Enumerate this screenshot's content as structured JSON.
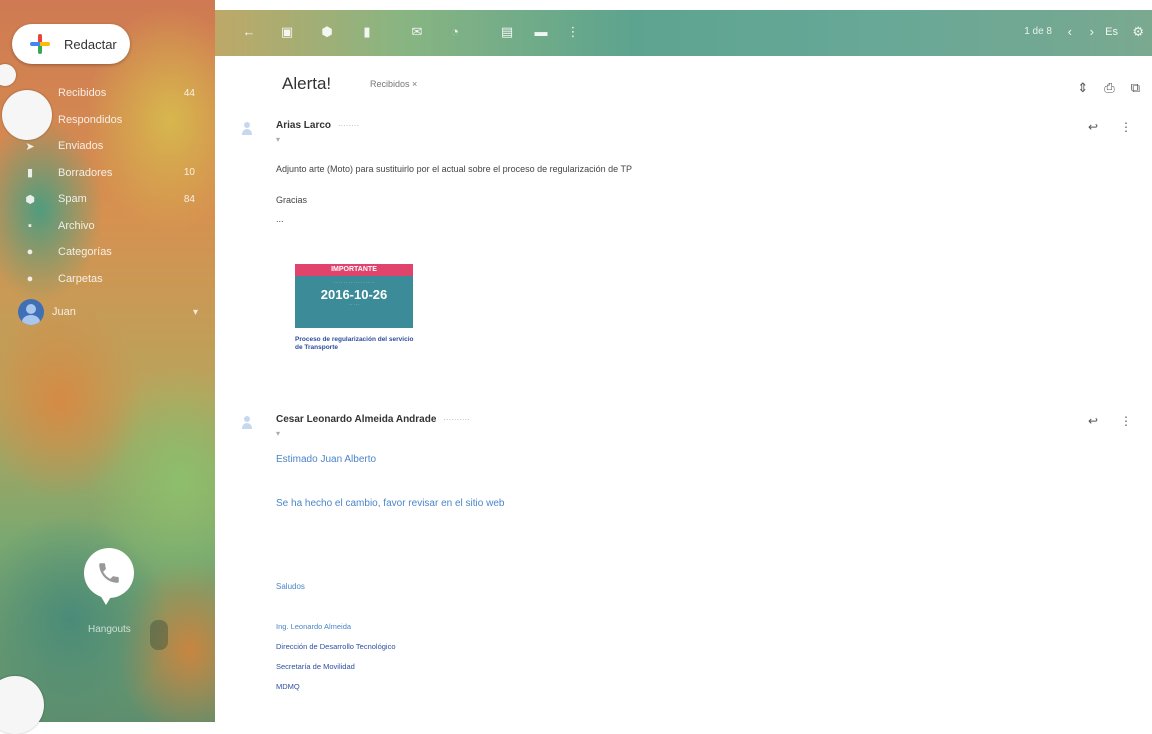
{
  "sidebar": {
    "compose_label": "Redactar",
    "items": [
      {
        "label": "Recibidos",
        "count": "44",
        "icon": "inbox-icon"
      },
      {
        "label": "Respondidos",
        "count": "",
        "icon": "reply-icon"
      },
      {
        "label": "Enviados",
        "count": "",
        "icon": "send-icon"
      },
      {
        "label": "Borradores",
        "count": "10",
        "icon": "draft-icon"
      },
      {
        "label": "Spam",
        "count": "84",
        "icon": "spam-icon"
      },
      {
        "label": "Archivo",
        "count": "",
        "icon": "archive-icon"
      },
      {
        "label": "Categorías",
        "count": "",
        "icon": "label-icon"
      },
      {
        "label": "Carpetas",
        "count": "",
        "icon": "folder-icon"
      }
    ],
    "account_label": "Juan",
    "hangouts_label": "Hangouts"
  },
  "topbar": {
    "pager": "1 de 8"
  },
  "message": {
    "subject": "Alerta!",
    "label_chip": "Recibidos ×"
  },
  "msg1": {
    "sender": "Arias Larco",
    "body": "Adjunto arte (Moto) para sustituirlo por el actual sobre el proceso de regularización de TP",
    "thanks": "Gracias",
    "ellipsis": "...",
    "attachment": {
      "banner": "IMPORTANTE",
      "date": "2016-10-26",
      "caption": "Proceso de regularización del servicio de Transporte"
    }
  },
  "msg2": {
    "sender": "Cesar Leonardo Almeida Andrade",
    "greeting": "Estimado Juan Alberto",
    "text": "Se ha hecho el cambio, favor revisar en el sitio web",
    "closing": "Saludos",
    "sig1": "Ing. Leonardo Almeida",
    "sig2": "Dirección de Desarrollo Tecnológico",
    "sig3": "Secretaría de Movilidad",
    "sig4": "MDMQ"
  }
}
